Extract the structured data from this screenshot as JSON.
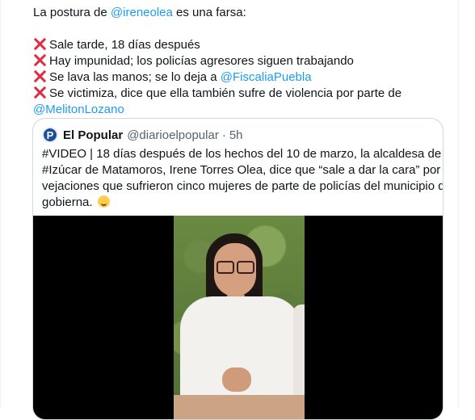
{
  "tweet": {
    "intro_before": "La postura de",
    "intro_mention": "@ireneolea",
    "intro_after": "es una farsa:",
    "bullet1": "Sale tarde, 18 días después",
    "bullet2": "Hay impunidad; los policías agresores siguen trabajando",
    "bullet3_before": "Se lava las manos; se lo deja a",
    "bullet3_mention": "@FiscaliaPuebla",
    "bullet4": "Se victimiza, dice que ella también sufre de violencia por parte de",
    "bullet4_mention": "@MelitonLozano",
    "bullet_icon": "cross-mark-icon"
  },
  "quote": {
    "avatar_letter": "P",
    "name": "El Popular",
    "handle": "@diarioelpopular",
    "separator": "·",
    "time": "5h",
    "line1": "#VIDEO | 18 días después de los hechos del 10 de marzo, la alcaldesa de",
    "line2": "#Izúcar de Matamoros, Irene Torres Olea, dice que “sale a dar la cara” por las",
    "line3": "vejaciones que sufrieron cinco mujeres de parte de policías del municipio que",
    "line4": "gobierna.",
    "emoji_icon": "grimacing-face-icon"
  },
  "colors": {
    "accent": "#1d9bf0",
    "cross": "#dd2e44",
    "text": "#0f1419",
    "secondary": "#536471",
    "border": "#cfd9de"
  }
}
